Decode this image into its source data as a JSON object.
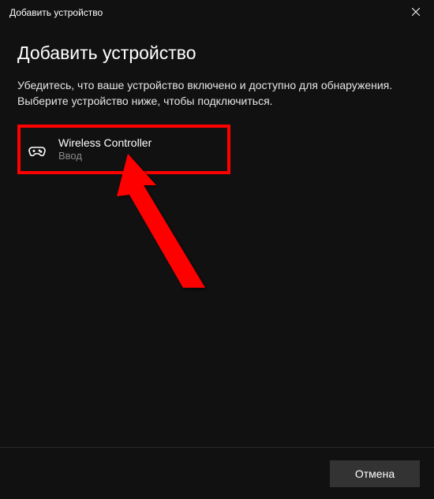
{
  "titlebar": {
    "title": "Добавить устройство"
  },
  "content": {
    "heading": "Добавить устройство",
    "instructions": "Убедитесь, что ваше устройство включено и доступно для обнаружения. Выберите устройство ниже, чтобы подключиться."
  },
  "device": {
    "name": "Wireless Controller",
    "type": "Ввод"
  },
  "footer": {
    "cancel_label": "Отмена"
  }
}
